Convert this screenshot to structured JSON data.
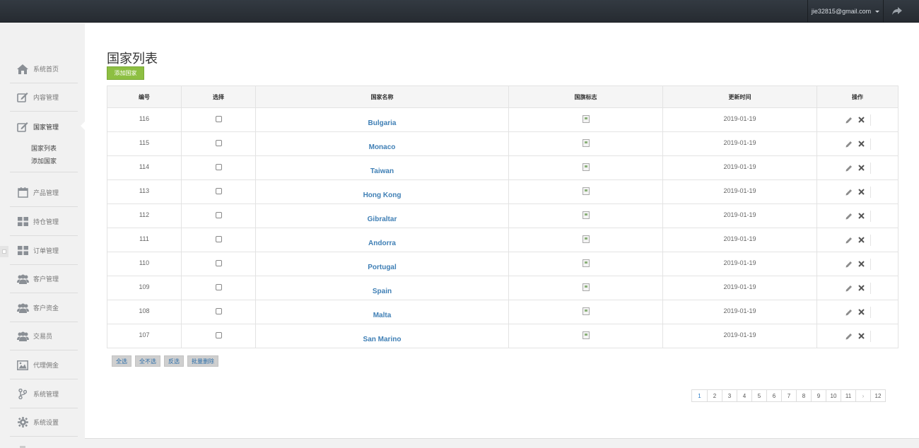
{
  "topbar": {
    "user_email": "jie32815@gmail.com"
  },
  "sidebar": {
    "items": [
      {
        "label": "系统首页",
        "icon": "home-icon"
      },
      {
        "label": "内容管理",
        "icon": "edit-icon"
      },
      {
        "label": "国家管理",
        "icon": "edit-icon"
      },
      {
        "label": "产品管理",
        "icon": "calendar-icon"
      },
      {
        "label": "持仓管理",
        "icon": "grid-icon"
      },
      {
        "label": "订单管理",
        "icon": "grid-icon"
      },
      {
        "label": "客户管理",
        "icon": "users-icon"
      },
      {
        "label": "客户资金",
        "icon": "users-icon"
      },
      {
        "label": "交易员",
        "icon": "users-icon"
      },
      {
        "label": "代理佣金",
        "icon": "picture-icon"
      },
      {
        "label": "系统管理",
        "icon": "fork-icon"
      },
      {
        "label": "系统设置",
        "icon": "gear-icon"
      }
    ],
    "submenu": [
      "国家列表",
      "添加国家"
    ]
  },
  "main": {
    "title": "国家列表",
    "add_button": "添加国家",
    "columns": [
      "编号",
      "选择",
      "国家名称",
      "国旗标志",
      "更新时间",
      "操作"
    ],
    "rows": [
      {
        "id": "116",
        "name": "Bulgaria",
        "date": "2019-01-19"
      },
      {
        "id": "115",
        "name": "Monaco",
        "date": "2019-01-19"
      },
      {
        "id": "114",
        "name": "Taiwan",
        "date": "2019-01-19"
      },
      {
        "id": "113",
        "name": "Hong Kong",
        "date": "2019-01-19"
      },
      {
        "id": "112",
        "name": "Gibraltar",
        "date": "2019-01-19"
      },
      {
        "id": "111",
        "name": "Andorra",
        "date": "2019-01-19"
      },
      {
        "id": "110",
        "name": "Portugal",
        "date": "2019-01-19"
      },
      {
        "id": "109",
        "name": "Spain",
        "date": "2019-01-19"
      },
      {
        "id": "108",
        "name": "Malta",
        "date": "2019-01-19"
      },
      {
        "id": "107",
        "name": "San Marino",
        "date": "2019-01-19"
      }
    ],
    "bulk_actions": [
      "全选",
      "全不选",
      "反选",
      "批量删除"
    ],
    "pagination": [
      "1",
      "2",
      "3",
      "4",
      "5",
      "6",
      "7",
      "8",
      "9",
      "10",
      "11",
      "›",
      "12"
    ],
    "current_page": "1"
  },
  "colors": {
    "accent": "#8dbf42",
    "link": "#3f7fb5",
    "topbar": "#2c3238"
  }
}
